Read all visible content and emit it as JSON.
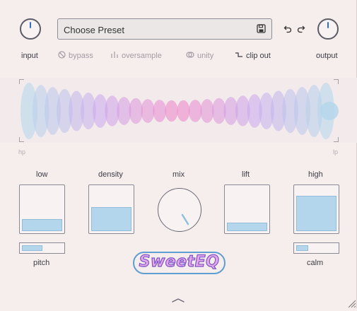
{
  "header": {
    "input_label": "input",
    "output_label": "output",
    "preset": {
      "label": "Choose Preset",
      "save_icon": "save-icon"
    },
    "undo_icon": "undo-icon",
    "redo_icon": "redo-icon"
  },
  "toggles": [
    {
      "label": "bypass",
      "icon": "bypass-icon",
      "active": false
    },
    {
      "label": "oversample",
      "icon": "oversample-icon",
      "active": false
    },
    {
      "label": "unity",
      "icon": "unity-icon",
      "active": false
    },
    {
      "label": "clip out",
      "icon": "clip-out-icon",
      "active": true
    }
  ],
  "visualizer": {
    "left_label": "hp",
    "right_label": "lp"
  },
  "controls": {
    "low": {
      "label": "low",
      "level": 0.28
    },
    "density": {
      "label": "density",
      "level": 0.55
    },
    "mix": {
      "label": "mix"
    },
    "lift": {
      "label": "lift",
      "level": 0.2
    },
    "high": {
      "label": "high",
      "level": 0.8
    },
    "pitch": {
      "label": "pitch",
      "level": 0.5
    },
    "calm": {
      "label": "calm",
      "level": 0.3
    }
  },
  "logo": {
    "text": "SweetEQ"
  },
  "colors": {
    "accent_blue": "#2d6fd6",
    "fill_blue": "#b3d6ec",
    "pink": "#ef7fc8",
    "purple": "#c9a6ee"
  }
}
